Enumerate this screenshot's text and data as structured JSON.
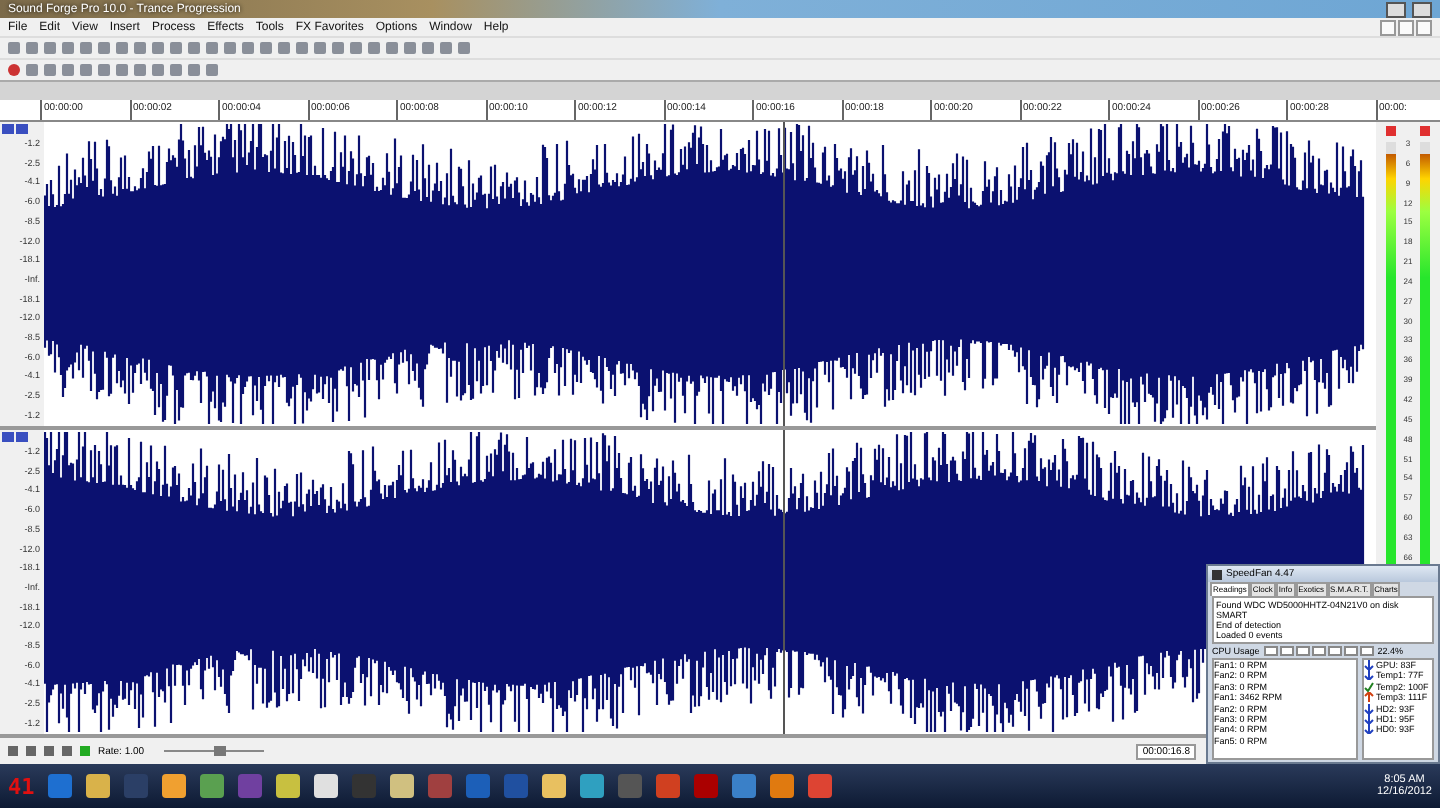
{
  "window": {
    "title": "Sound Forge Pro 10.0 - Trance Progression"
  },
  "menu": [
    "File",
    "Edit",
    "View",
    "Insert",
    "Process",
    "Effects",
    "Tools",
    "FX Favorites",
    "Options",
    "Window",
    "Help"
  ],
  "ruler": {
    "ticks": [
      "00:00:00",
      "00:00:02",
      "00:00:04",
      "00:00:06",
      "00:00:08",
      "00:00:10",
      "00:00:12",
      "00:00:14",
      "00:00:16",
      "00:00:18",
      "00:00:20",
      "00:00:22",
      "00:00:24",
      "00:00:26",
      "00:00:28",
      "00:00:"
    ]
  },
  "tracks": [
    {
      "scale": [
        "-1.2",
        "-2.5",
        "-4.1",
        "-6.0",
        "-8.5",
        "-12.0",
        "-18.1",
        "-Inf.",
        "-18.1",
        "-12.0",
        "-8.5",
        "-6.0",
        "-4.1",
        "-2.5",
        "-1.2"
      ]
    },
    {
      "scale": [
        "-1.2",
        "-2.5",
        "-4.1",
        "-6.0",
        "-8.5",
        "-12.0",
        "-18.1",
        "-Inf.",
        "-18.1",
        "-12.0",
        "-8.5",
        "-6.0",
        "-4.1",
        "-2.5",
        "-1.2"
      ]
    }
  ],
  "meters": {
    "channels": [
      {
        "level": 0.97
      },
      {
        "level": 0.97
      }
    ],
    "scale": [
      "3",
      "6",
      "9",
      "12",
      "15",
      "18",
      "21",
      "24",
      "27",
      "30",
      "33",
      "36",
      "39",
      "42",
      "45",
      "48",
      "51",
      "54",
      "57",
      "60",
      "63",
      "66"
    ]
  },
  "transport": {
    "rate": "Rate: 1.00",
    "rate_slider": {
      "level": 0.55
    },
    "time": "00:00:16.8"
  },
  "taskbar": {
    "counter": "41",
    "time": "8:05 AM",
    "date": "12/16/2012"
  },
  "speedfan": {
    "title": "SpeedFan 4.47",
    "tabs": [
      {
        "label": "Readings",
        "selected": true
      },
      {
        "label": "Clock",
        "selected": false
      },
      {
        "label": "Info",
        "selected": false
      },
      {
        "label": "Exotics",
        "selected": false
      },
      {
        "label": "S.M.A.R.T.",
        "selected": false
      },
      {
        "label": "Charts",
        "selected": false
      }
    ],
    "log": [
      "Found WDC WD5000HHTZ-04N21V0 on disk SMART",
      "End of detection",
      "Loaded 0 events"
    ],
    "cpu_label": "CPU Usage",
    "cpu_value": "22.4%",
    "fans": [
      "Fan1: 0 RPM",
      "Fan2: 0 RPM",
      "Fan3: 0 RPM",
      "Fan1: 3462 RPM",
      "Fan2: 0 RPM",
      "Fan3: 0 RPM",
      "Fan4: 0 RPM",
      "Fan5: 0 RPM"
    ],
    "temps": [
      {
        "kind": "down",
        "label": "GPU: 83F"
      },
      {
        "kind": "down",
        "label": "Temp1: 77F"
      },
      {
        "kind": "ok",
        "label": "Temp2: 100F"
      },
      {
        "kind": "up",
        "label": "Temp3: 111F"
      },
      {
        "kind": "down",
        "label": "HD2: 93F"
      },
      {
        "kind": "down",
        "label": "HD1: 95F"
      },
      {
        "kind": "down",
        "label": "HD0: 93F"
      }
    ]
  }
}
